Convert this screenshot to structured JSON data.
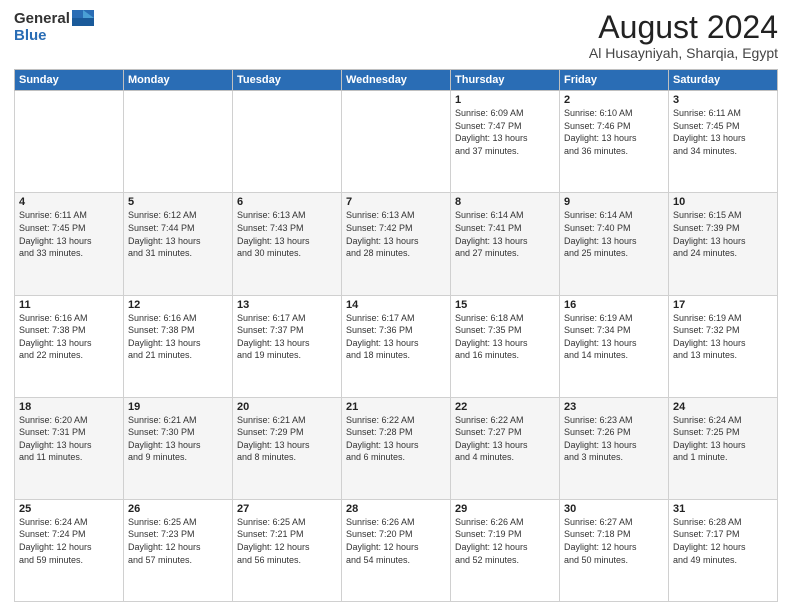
{
  "header": {
    "logo_general": "General",
    "logo_blue": "Blue",
    "title": "August 2024",
    "location": "Al Husayniyah, Sharqia, Egypt"
  },
  "days_of_week": [
    "Sunday",
    "Monday",
    "Tuesday",
    "Wednesday",
    "Thursday",
    "Friday",
    "Saturday"
  ],
  "weeks": [
    [
      {
        "day": "",
        "info": ""
      },
      {
        "day": "",
        "info": ""
      },
      {
        "day": "",
        "info": ""
      },
      {
        "day": "",
        "info": ""
      },
      {
        "day": "1",
        "info": "Sunrise: 6:09 AM\nSunset: 7:47 PM\nDaylight: 13 hours\nand 37 minutes."
      },
      {
        "day": "2",
        "info": "Sunrise: 6:10 AM\nSunset: 7:46 PM\nDaylight: 13 hours\nand 36 minutes."
      },
      {
        "day": "3",
        "info": "Sunrise: 6:11 AM\nSunset: 7:45 PM\nDaylight: 13 hours\nand 34 minutes."
      }
    ],
    [
      {
        "day": "4",
        "info": "Sunrise: 6:11 AM\nSunset: 7:45 PM\nDaylight: 13 hours\nand 33 minutes."
      },
      {
        "day": "5",
        "info": "Sunrise: 6:12 AM\nSunset: 7:44 PM\nDaylight: 13 hours\nand 31 minutes."
      },
      {
        "day": "6",
        "info": "Sunrise: 6:13 AM\nSunset: 7:43 PM\nDaylight: 13 hours\nand 30 minutes."
      },
      {
        "day": "7",
        "info": "Sunrise: 6:13 AM\nSunset: 7:42 PM\nDaylight: 13 hours\nand 28 minutes."
      },
      {
        "day": "8",
        "info": "Sunrise: 6:14 AM\nSunset: 7:41 PM\nDaylight: 13 hours\nand 27 minutes."
      },
      {
        "day": "9",
        "info": "Sunrise: 6:14 AM\nSunset: 7:40 PM\nDaylight: 13 hours\nand 25 minutes."
      },
      {
        "day": "10",
        "info": "Sunrise: 6:15 AM\nSunset: 7:39 PM\nDaylight: 13 hours\nand 24 minutes."
      }
    ],
    [
      {
        "day": "11",
        "info": "Sunrise: 6:16 AM\nSunset: 7:38 PM\nDaylight: 13 hours\nand 22 minutes."
      },
      {
        "day": "12",
        "info": "Sunrise: 6:16 AM\nSunset: 7:38 PM\nDaylight: 13 hours\nand 21 minutes."
      },
      {
        "day": "13",
        "info": "Sunrise: 6:17 AM\nSunset: 7:37 PM\nDaylight: 13 hours\nand 19 minutes."
      },
      {
        "day": "14",
        "info": "Sunrise: 6:17 AM\nSunset: 7:36 PM\nDaylight: 13 hours\nand 18 minutes."
      },
      {
        "day": "15",
        "info": "Sunrise: 6:18 AM\nSunset: 7:35 PM\nDaylight: 13 hours\nand 16 minutes."
      },
      {
        "day": "16",
        "info": "Sunrise: 6:19 AM\nSunset: 7:34 PM\nDaylight: 13 hours\nand 14 minutes."
      },
      {
        "day": "17",
        "info": "Sunrise: 6:19 AM\nSunset: 7:32 PM\nDaylight: 13 hours\nand 13 minutes."
      }
    ],
    [
      {
        "day": "18",
        "info": "Sunrise: 6:20 AM\nSunset: 7:31 PM\nDaylight: 13 hours\nand 11 minutes."
      },
      {
        "day": "19",
        "info": "Sunrise: 6:21 AM\nSunset: 7:30 PM\nDaylight: 13 hours\nand 9 minutes."
      },
      {
        "day": "20",
        "info": "Sunrise: 6:21 AM\nSunset: 7:29 PM\nDaylight: 13 hours\nand 8 minutes."
      },
      {
        "day": "21",
        "info": "Sunrise: 6:22 AM\nSunset: 7:28 PM\nDaylight: 13 hours\nand 6 minutes."
      },
      {
        "day": "22",
        "info": "Sunrise: 6:22 AM\nSunset: 7:27 PM\nDaylight: 13 hours\nand 4 minutes."
      },
      {
        "day": "23",
        "info": "Sunrise: 6:23 AM\nSunset: 7:26 PM\nDaylight: 13 hours\nand 3 minutes."
      },
      {
        "day": "24",
        "info": "Sunrise: 6:24 AM\nSunset: 7:25 PM\nDaylight: 13 hours\nand 1 minute."
      }
    ],
    [
      {
        "day": "25",
        "info": "Sunrise: 6:24 AM\nSunset: 7:24 PM\nDaylight: 12 hours\nand 59 minutes."
      },
      {
        "day": "26",
        "info": "Sunrise: 6:25 AM\nSunset: 7:23 PM\nDaylight: 12 hours\nand 57 minutes."
      },
      {
        "day": "27",
        "info": "Sunrise: 6:25 AM\nSunset: 7:21 PM\nDaylight: 12 hours\nand 56 minutes."
      },
      {
        "day": "28",
        "info": "Sunrise: 6:26 AM\nSunset: 7:20 PM\nDaylight: 12 hours\nand 54 minutes."
      },
      {
        "day": "29",
        "info": "Sunrise: 6:26 AM\nSunset: 7:19 PM\nDaylight: 12 hours\nand 52 minutes."
      },
      {
        "day": "30",
        "info": "Sunrise: 6:27 AM\nSunset: 7:18 PM\nDaylight: 12 hours\nand 50 minutes."
      },
      {
        "day": "31",
        "info": "Sunrise: 6:28 AM\nSunset: 7:17 PM\nDaylight: 12 hours\nand 49 minutes."
      }
    ]
  ]
}
